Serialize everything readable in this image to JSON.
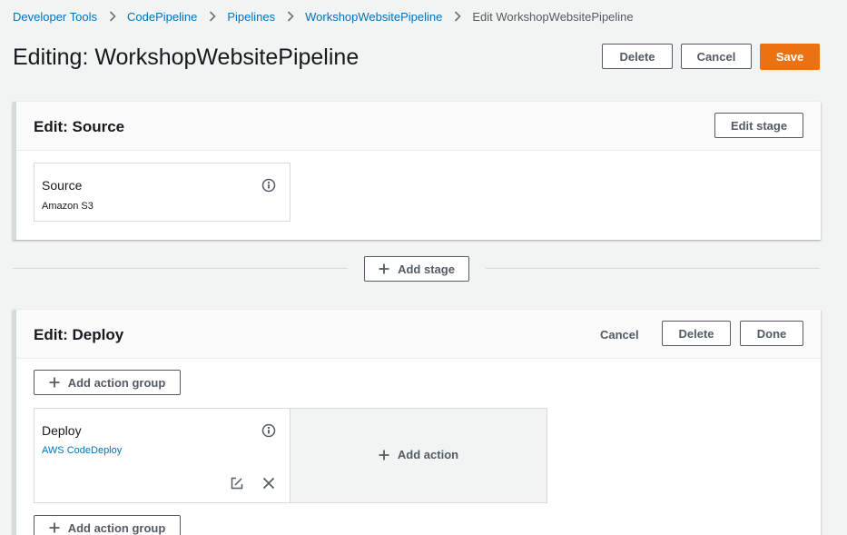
{
  "breadcrumb": {
    "items": [
      "Developer Tools",
      "CodePipeline",
      "Pipelines",
      "WorkshopWebsitePipeline"
    ],
    "current": "Edit WorkshopWebsitePipeline"
  },
  "page": {
    "title": "Editing: WorkshopWebsitePipeline",
    "delete_label": "Delete",
    "cancel_label": "Cancel",
    "save_label": "Save"
  },
  "source_stage": {
    "title": "Edit: Source",
    "edit_stage_label": "Edit stage",
    "action": {
      "name": "Source",
      "provider": "Amazon S3"
    }
  },
  "add_stage_label": "Add stage",
  "deploy_stage": {
    "title": "Edit: Deploy",
    "cancel_label": "Cancel",
    "delete_label": "Delete",
    "done_label": "Done",
    "add_action_group_label": "Add action group",
    "action": {
      "name": "Deploy",
      "provider": "AWS CodeDeploy"
    },
    "add_action_label": "Add action"
  },
  "colors": {
    "link": "#0073bb",
    "primary": "#ec7211",
    "background": "#f2f3f3",
    "text": "#16191f"
  },
  "icons": [
    "chevron-right-icon",
    "info-icon",
    "plus-icon",
    "edit-icon",
    "close-icon"
  ]
}
